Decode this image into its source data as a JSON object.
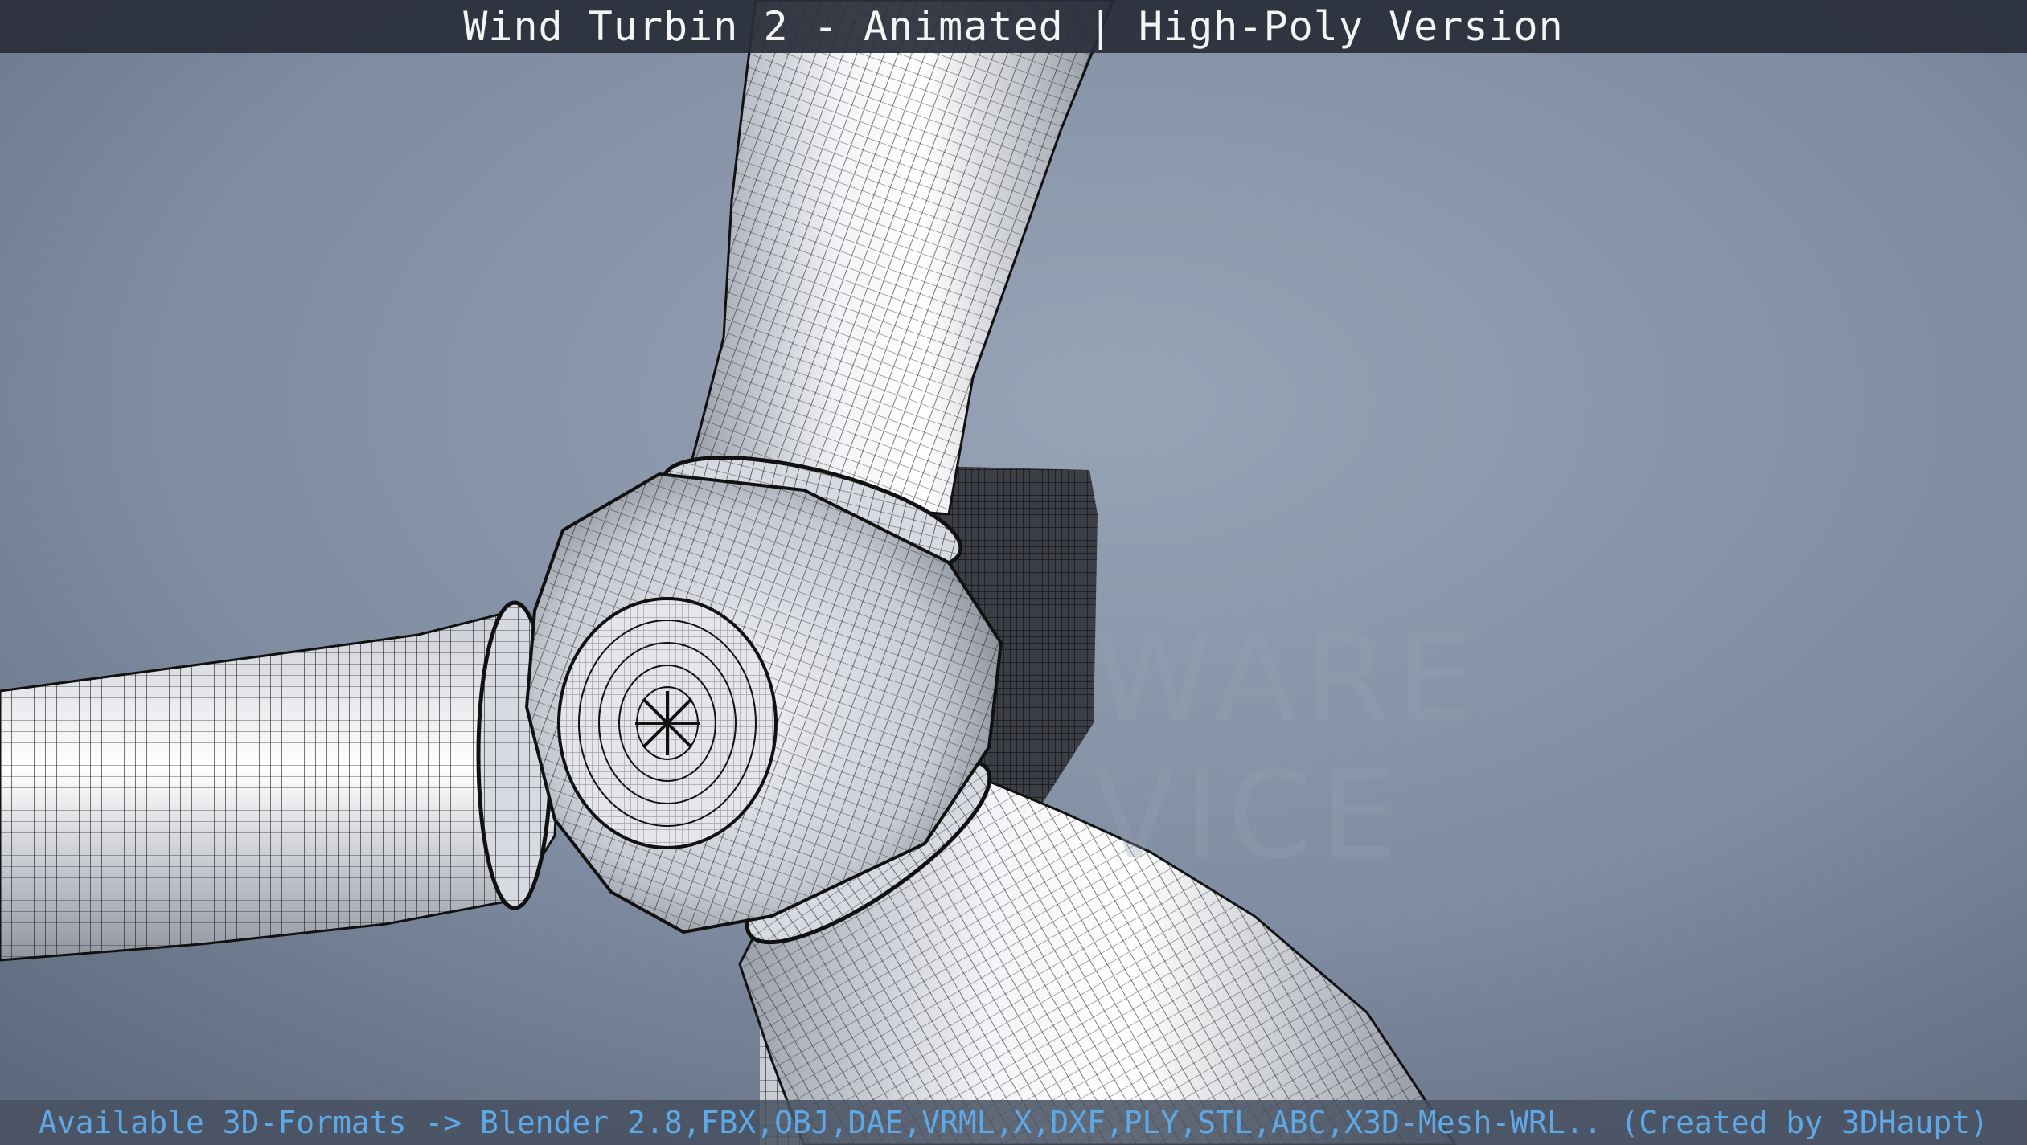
{
  "header": {
    "title": "Wind Turbin 2 - Animated | High-Poly Version"
  },
  "footer": {
    "formats_text": "Available 3D-Formats -> Blender 2.8,FBX,OBJ,DAE,VRML,X,DXF,PLY,STL,ABC,X3D-Mesh-WRL.. (Created by 3DHaupt)"
  },
  "viewport": {
    "subject": "wind turbine hub with three blades, wireframe overlay",
    "background_color": "#7d8aa0",
    "mesh_color": "#e8ebf0",
    "wire_color": "#1a1a1a"
  },
  "colors": {
    "title_text": "#f4f4f4",
    "footer_text": "#5ea8e6"
  }
}
